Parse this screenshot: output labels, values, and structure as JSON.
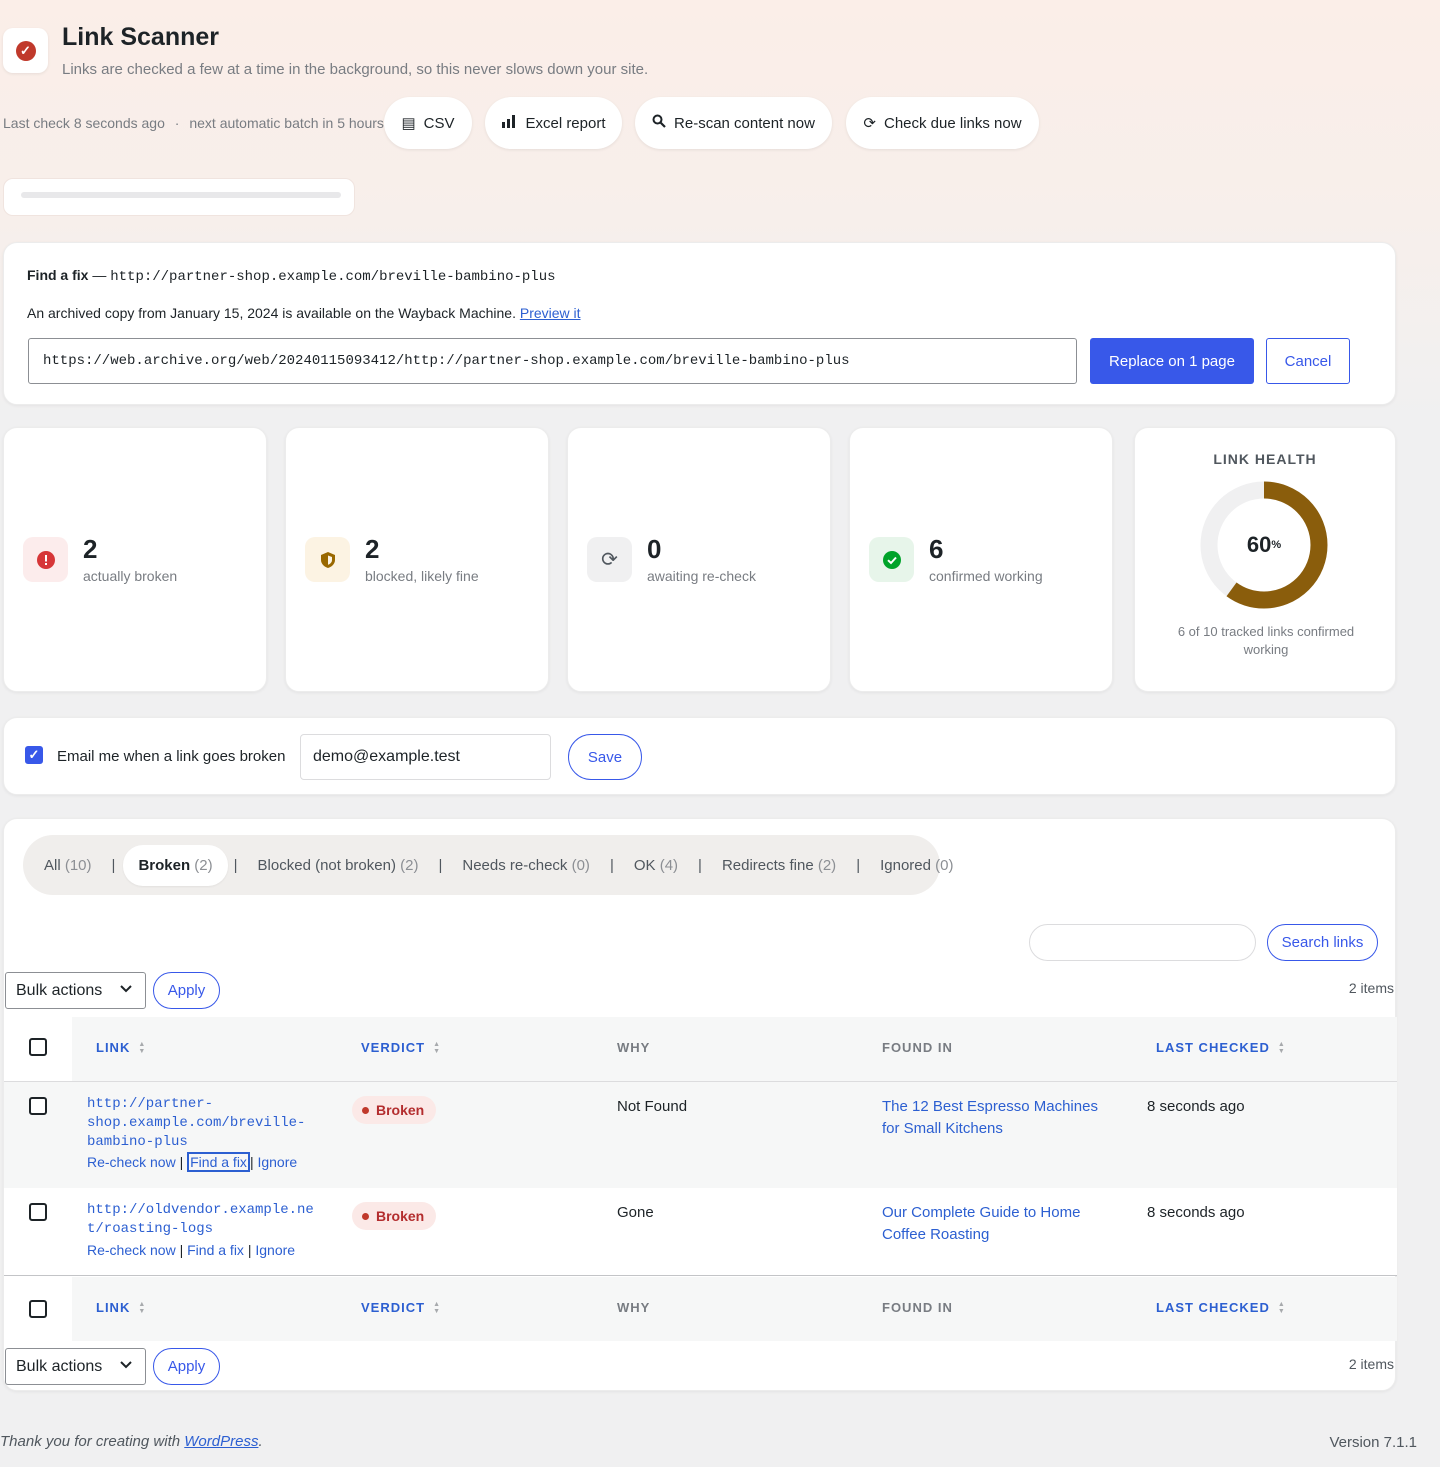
{
  "header": {
    "title": "Link Scanner",
    "subtitle": "Links are checked a few at a time in the background, so this never slows down your site.",
    "last_check": "Last check 8 seconds ago",
    "separator": "·",
    "next_batch": "next automatic batch in 5 hours"
  },
  "toolbar": {
    "csv": "CSV",
    "excel": "Excel report",
    "rescan": "Re-scan content now",
    "check_due": "Check due links now"
  },
  "fix": {
    "heading": "Find a fix",
    "dash": "—",
    "url": "http://partner-shop.example.com/breville-bambino-plus",
    "note": "An archived copy from January 15, 2024 is available on the Wayback Machine.",
    "preview": "Preview it",
    "archive_url": "https://web.archive.org/web/20240115093412/http://partner-shop.example.com/breville-bambino-plus",
    "replace_label": "Replace on 1 page",
    "cancel_label": "Cancel"
  },
  "stats": [
    {
      "value": "2",
      "label": "actually broken",
      "icon": "alert-icon",
      "color": "#d63638"
    },
    {
      "value": "2",
      "label": "blocked, likely fine",
      "icon": "shield-icon",
      "color": "#996800"
    },
    {
      "value": "0",
      "label": "awaiting re-check",
      "icon": "refresh-icon",
      "color": "#50575e"
    },
    {
      "value": "6",
      "label": "confirmed working",
      "icon": "check-icon",
      "color": "#00a32a"
    }
  ],
  "health": {
    "title": "LINK HEALTH",
    "percent": 60,
    "percent_label": "60",
    "percent_sign": "%",
    "caption": "6 of 10 tracked links confirmed working",
    "ring_color": "#8a5d0c"
  },
  "email": {
    "label": "Email me when a link goes broken",
    "value": "demo@example.test",
    "save_label": "Save"
  },
  "filters": {
    "items": [
      {
        "label": "All",
        "count": "(10)"
      },
      {
        "label": "Broken",
        "count": "(2)"
      },
      {
        "label": "Blocked (not broken)",
        "count": "(2)"
      },
      {
        "label": "Needs re-check",
        "count": "(0)"
      },
      {
        "label": "OK",
        "count": "(4)"
      },
      {
        "label": "Redirects fine",
        "count": "(2)"
      },
      {
        "label": "Ignored",
        "count": "(0)"
      }
    ],
    "sep": "|"
  },
  "search": {
    "button": "Search links"
  },
  "bulk": {
    "label": "Bulk actions",
    "apply": "Apply",
    "items_count": "2 items"
  },
  "table": {
    "columns": {
      "link": "LINK",
      "verdict": "VERDICT",
      "why": "WHY",
      "found": "FOUND IN",
      "checked": "LAST CHECKED"
    },
    "rows": [
      {
        "link_lines": [
          "http://partner-",
          "shop.example.com/breville-",
          "bambino-plus"
        ],
        "recheck": "Re-check now",
        "findfix": "Find a fix",
        "ignore": "Ignore",
        "sep": "|",
        "verdict": "Broken",
        "why": "Not Found",
        "found": "The 12 Best Espresso Machines for Small Kitchens",
        "checked": "8 seconds ago"
      },
      {
        "link_lines": [
          "http://oldvendor.example.ne",
          "t/roasting-logs"
        ],
        "recheck": "Re-check now",
        "findfix": "Find a fix",
        "ignore": "Ignore",
        "sep": "|",
        "verdict": "Broken",
        "why": "Gone",
        "found": "Our Complete Guide to Home Coffee Roasting",
        "checked": "8 seconds ago"
      }
    ]
  },
  "footer": {
    "thanks": "Thank you for creating with",
    "wp": "WordPress",
    "period": ".",
    "version": "Version 7.1.1"
  }
}
